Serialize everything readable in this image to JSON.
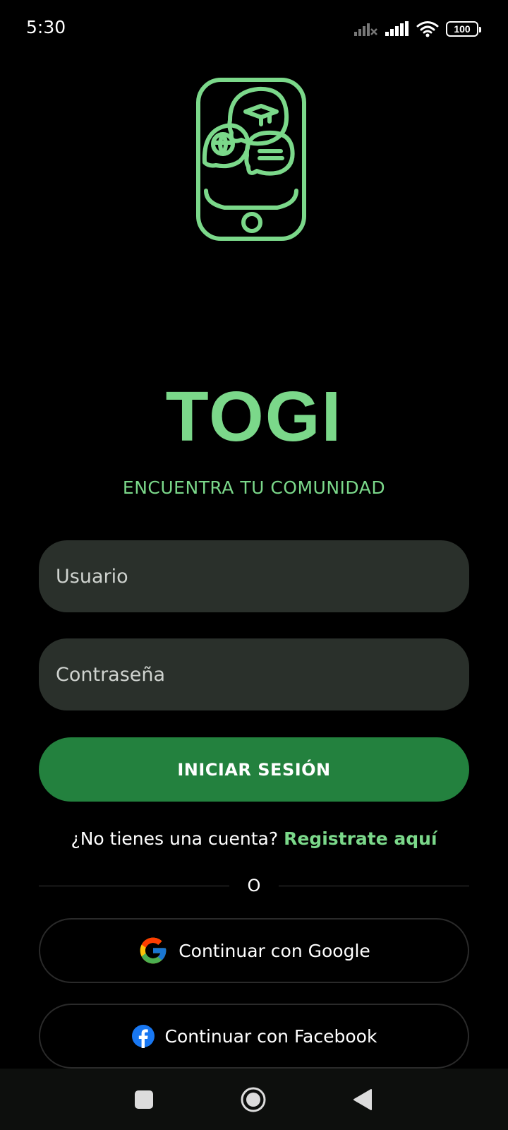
{
  "status_bar": {
    "time": "5:30",
    "battery_level": "100",
    "icons": [
      "signal-off-icon",
      "signal-icon",
      "wifi-icon",
      "battery-icon"
    ]
  },
  "app": {
    "title": "TOGI",
    "subtitle": "ENCUENTRA TU COMUNIDAD",
    "logo_icon": "phone-chat-logo"
  },
  "form": {
    "username_placeholder": "Usuario",
    "password_placeholder": "Contraseña",
    "login_label": "INICIAR SESIÓN"
  },
  "register": {
    "prompt": "¿No tienes una cuenta?",
    "link_label": "Registrate aquí"
  },
  "divider": {
    "text": "O"
  },
  "social": {
    "google_label": "Continuar con Google",
    "facebook_label": "Continuar con Facebook"
  },
  "nav": {
    "icons": [
      "recent-apps-icon",
      "home-icon",
      "back-icon"
    ]
  },
  "colors": {
    "accent": "#7bd88a",
    "primary_button": "#23813e",
    "input_background": "#2a302b",
    "background": "#000000"
  }
}
